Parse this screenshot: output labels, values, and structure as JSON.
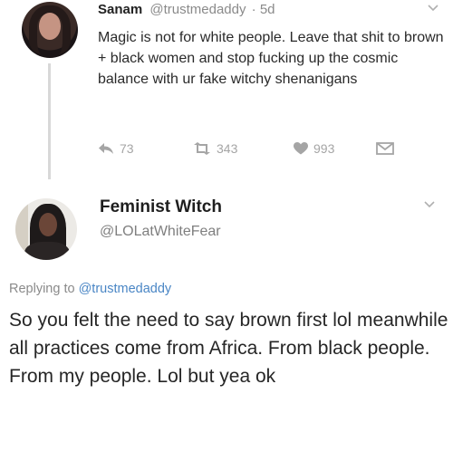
{
  "tweet1": {
    "name": "Sanam",
    "handle": "@trustmedaddy",
    "time": "· 5d",
    "text": "Magic is not for white people. Leave that shit to brown + black women and stop fucking up the cosmic balance with ur fake witchy shenanigans",
    "replies": "73",
    "retweets": "343",
    "likes": "993"
  },
  "tweet2": {
    "name": "Feminist Witch",
    "handle": "@LOLatWhiteFear",
    "replying_prefix": "Replying to ",
    "replying_to": "@trustmedaddy",
    "text": "So you felt the need to say brown first lol meanwhile all practices come from Africa. From black people. From my people. Lol but yea ok"
  },
  "icons": {
    "reply": "reply-icon",
    "retweet": "retweet-icon",
    "like": "heart-icon",
    "dm": "envelope-icon",
    "more": "chevron-down-icon"
  },
  "colors": {
    "mention": "#4a86c5",
    "muted": "#8a8a8a",
    "icon": "#a5a5a5"
  }
}
